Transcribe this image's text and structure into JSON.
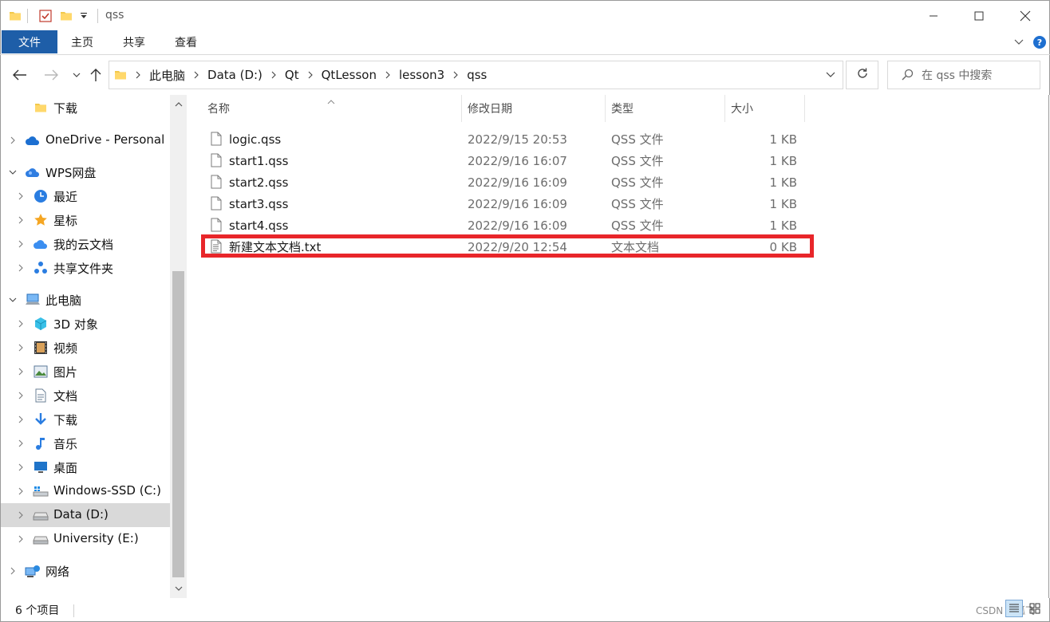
{
  "window": {
    "title": "qss",
    "icons": [
      "folder-icon",
      "properties-icon",
      "new-folder-icon",
      "customize-qat-icon"
    ],
    "controls": [
      "minimize-icon",
      "maximize-icon",
      "close-icon"
    ]
  },
  "ribbon": {
    "file_tab": "文件",
    "tabs": [
      "主页",
      "共享",
      "查看"
    ],
    "colors": {
      "file_tab_bg": "#1e5ea8"
    }
  },
  "address": {
    "crumbs": [
      "此电脑",
      "Data (D:)",
      "Qt",
      "QtLesson",
      "lesson3",
      "qss"
    ],
    "search_placeholder": "在 qss 中搜索"
  },
  "nav": {
    "items": [
      {
        "label": "下载",
        "icon": "folder-icon",
        "chevron": false,
        "indent": 1
      },
      {
        "label": "OneDrive - Personal",
        "icon": "onedrive-cloud-icon",
        "chevron": "right",
        "indent": 0
      },
      {
        "label": "WPS网盘",
        "icon": "wps-cloud-icon",
        "chevron": "down",
        "indent": 0
      },
      {
        "label": "最近",
        "icon": "clock-icon",
        "chevron": "right",
        "indent": 1
      },
      {
        "label": "星标",
        "icon": "star-icon",
        "chevron": "right",
        "indent": 1
      },
      {
        "label": "我的云文档",
        "icon": "cloud-docs-icon",
        "chevron": "right",
        "indent": 1
      },
      {
        "label": "共享文件夹",
        "icon": "shared-folder-icon",
        "chevron": "right",
        "indent": 1
      },
      {
        "label": "此电脑",
        "icon": "this-pc-icon",
        "chevron": "down",
        "indent": 0
      },
      {
        "label": "3D 对象",
        "icon": "3d-objects-icon",
        "chevron": "right",
        "indent": 1
      },
      {
        "label": "视频",
        "icon": "video-icon",
        "chevron": "right",
        "indent": 1
      },
      {
        "label": "图片",
        "icon": "pictures-icon",
        "chevron": "right",
        "indent": 1
      },
      {
        "label": "文档",
        "icon": "documents-icon",
        "chevron": "right",
        "indent": 1
      },
      {
        "label": "下载",
        "icon": "download-arrow-icon",
        "chevron": "right",
        "indent": 1
      },
      {
        "label": "音乐",
        "icon": "music-note-icon",
        "chevron": "right",
        "indent": 1
      },
      {
        "label": "桌面",
        "icon": "desktop-icon",
        "chevron": "right",
        "indent": 1
      },
      {
        "label": "Windows-SSD (C:)",
        "icon": "windows-drive-icon",
        "chevron": "right",
        "indent": 1
      },
      {
        "label": "Data (D:)",
        "icon": "drive-icon",
        "chevron": "right",
        "indent": 1,
        "selected": true
      },
      {
        "label": "University (E:)",
        "icon": "drive-icon",
        "chevron": "right",
        "indent": 1
      },
      {
        "label": "网络",
        "icon": "network-icon",
        "chevron": "right",
        "indent": 0
      }
    ]
  },
  "columns": [
    "名称",
    "修改日期",
    "类型",
    "大小"
  ],
  "files": [
    {
      "name": "logic.qss",
      "modified": "2022/9/15 20:53",
      "type": "QSS 文件",
      "size": "1 KB",
      "icon": "file-icon"
    },
    {
      "name": "start1.qss",
      "modified": "2022/9/16 16:07",
      "type": "QSS 文件",
      "size": "1 KB",
      "icon": "file-icon"
    },
    {
      "name": "start2.qss",
      "modified": "2022/9/16 16:09",
      "type": "QSS 文件",
      "size": "1 KB",
      "icon": "file-icon"
    },
    {
      "name": "start3.qss",
      "modified": "2022/9/16 16:09",
      "type": "QSS 文件",
      "size": "1 KB",
      "icon": "file-icon"
    },
    {
      "name": "start4.qss",
      "modified": "2022/9/16 16:09",
      "type": "QSS 文件",
      "size": "1 KB",
      "icon": "file-icon"
    },
    {
      "name": "新建文本文档.txt",
      "modified": "2022/9/20 12:54",
      "type": "文本文档",
      "size": "0 KB",
      "icon": "text-file-icon"
    }
  ],
  "highlight_color": "#e8262a",
  "status": {
    "count": "6 个项目",
    "watermark": "CSDN @孤飞"
  }
}
